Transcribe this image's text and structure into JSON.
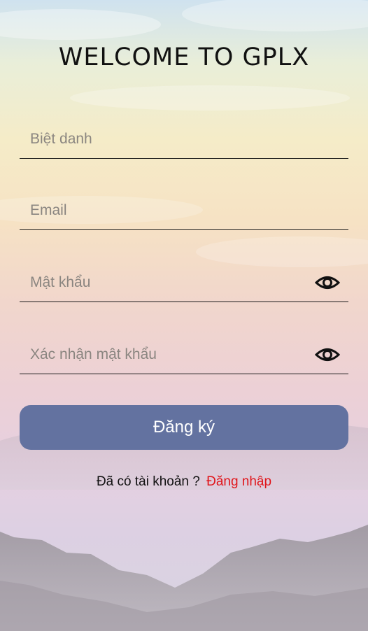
{
  "header": {
    "title": "WELCOME TO GPLX"
  },
  "form": {
    "nickname_placeholder": "Biệt danh",
    "email_placeholder": "Email",
    "password_placeholder": "Mật khẩu",
    "confirm_password_placeholder": "Xác nhận mật khẩu",
    "password_toggle_icon": "eye-icon",
    "confirm_toggle_icon": "eye-icon",
    "submit_label": "Đăng ký"
  },
  "footer": {
    "prompt_text": "Đã có tài khoản ?",
    "login_link": "Đăng nhập"
  },
  "colors": {
    "button": "#6372a0",
    "link": "#e0161b"
  }
}
